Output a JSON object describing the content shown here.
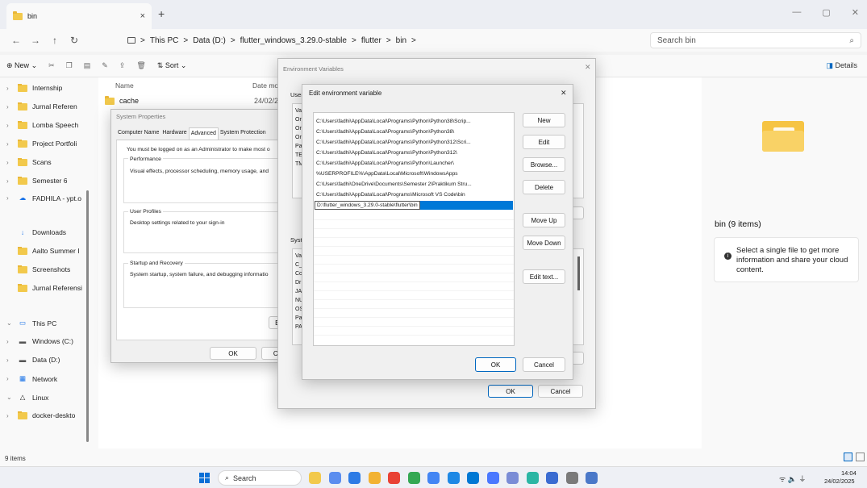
{
  "window": {
    "tab_title": "bin",
    "tab_close": "×",
    "tab_add": "+",
    "minimize": "—",
    "maximize": "▢",
    "close": "✕"
  },
  "nav": {
    "back": "←",
    "forward": "→",
    "up": "↑",
    "refresh": "↻"
  },
  "address": {
    "segments": [
      "This PC",
      "Data (D:)",
      "flutter_windows_3.29.0-stable",
      "flutter",
      "bin"
    ],
    "separator": ">"
  },
  "search": {
    "placeholder": "Search bin",
    "icon": "⌕"
  },
  "commandbar": {
    "new_label": "New",
    "sort_label": "Sort",
    "details_label": "Details"
  },
  "sidebar": {
    "items": [
      {
        "label": "Internship",
        "icon": "folder"
      },
      {
        "label": "Jurnal Referen",
        "icon": "folder"
      },
      {
        "label": "Lomba Speech",
        "icon": "folder"
      },
      {
        "label": "Project Portfoli",
        "icon": "folder"
      },
      {
        "label": "Scans",
        "icon": "folder"
      },
      {
        "label": "Semester 6",
        "icon": "folder"
      },
      {
        "label": "FADHILA - ypt.o",
        "icon": "cloud"
      },
      {
        "label": "Downloads",
        "icon": "download"
      },
      {
        "label": "Aalto Summer I",
        "icon": "folder"
      },
      {
        "label": "Screenshots",
        "icon": "folder"
      },
      {
        "label": "Jurnal Referensi",
        "icon": "folder"
      },
      {
        "label": "This PC",
        "icon": "monitor"
      },
      {
        "label": "Windows (C:)",
        "icon": "drive"
      },
      {
        "label": "Data (D:)",
        "icon": "drive"
      },
      {
        "label": "Network",
        "icon": "network"
      },
      {
        "label": "Linux",
        "icon": "linux"
      },
      {
        "label": "docker-deskto",
        "icon": "folder"
      }
    ]
  },
  "filelist": {
    "col_name": "Name",
    "col_date": "Date mo",
    "row_name": "cache",
    "row_date": "24/02/20"
  },
  "details_pane": {
    "title": "bin (9 items)",
    "message": "Select a single file to get more information and share your cloud content."
  },
  "status": {
    "items": "9 items"
  },
  "system_properties": {
    "title": "System Properties",
    "tabs": [
      "Computer Name",
      "Hardware",
      "Advanced",
      "System Protection"
    ],
    "admin_note": "You must be logged on as an Administrator to make most o",
    "perf_title": "Performance",
    "perf_desc": "Visual effects, processor scheduling, memory usage, and",
    "profiles_title": "User Profiles",
    "profiles_desc": "Desktop settings related to your sign-in",
    "startup_title": "Startup and Recovery",
    "startup_desc": "System startup, system failure, and debugging informatio",
    "env_btn": "Env",
    "ok": "OK",
    "cancel": "Ca"
  },
  "env_vars": {
    "title": "Environment Variables",
    "user_label": "User",
    "sys_label": "Syst",
    "user_col": [
      "Va",
      "On",
      "On",
      "On",
      "Pa",
      "TE",
      "TM"
    ],
    "sys_col": [
      "Va",
      "C_",
      "Co",
      "Dr",
      "JA",
      "NU",
      "OS",
      "Pa",
      "PA"
    ],
    "ok": "OK",
    "cancel": "Cancel"
  },
  "edit_env": {
    "title": "Edit environment variable",
    "close": "✕",
    "entries": [
      "C:\\Users\\fadhi\\AppData\\Local\\Programs\\Python\\Python38\\Scrip...",
      "C:\\Users\\fadhi\\AppData\\Local\\Programs\\Python\\Python38\\",
      "C:\\Users\\fadhi\\AppData\\Local\\Programs\\Python\\Python312\\Scri...",
      "C:\\Users\\fadhi\\AppData\\Local\\Programs\\Python\\Python312\\",
      "C:\\Users\\fadhi\\AppData\\Local\\Programs\\Python\\Launcher\\",
      "%USERPROFILE%\\AppData\\Local\\Microsoft\\WindowsApps",
      "C:\\Users\\fadhi\\OneDrive\\Documents\\Semester 2\\Praktikum Stru...",
      "C:\\Users\\fadhi\\AppData\\Local\\Programs\\Microsoft VS Code\\bin"
    ],
    "editing_value": "D:\\flutter_windows_3.29.0-stable\\flutter\\bin",
    "buttons": {
      "new": "New",
      "edit": "Edit",
      "browse": "Browse...",
      "delete": "Delete",
      "move_up": "Move Up",
      "move_down": "Move Down",
      "edit_text": "Edit text..."
    },
    "ok": "OK",
    "cancel": "Cancel"
  },
  "taskbar": {
    "search": "Search",
    "time": "14:04",
    "date": "24/02/2025",
    "tray": "ᯤ 🔈 ⏚",
    "apps": [
      {
        "name": "files-app",
        "color": "#f2c94c"
      },
      {
        "name": "copilot-app",
        "color": "#5b8def"
      },
      {
        "name": "store-app",
        "color": "#2d7be5"
      },
      {
        "name": "explorer-app",
        "color": "#f2b233"
      },
      {
        "name": "chrome-app",
        "color": "#e94235"
      },
      {
        "name": "chrome-alt-app",
        "color": "#34a853"
      },
      {
        "name": "chrome-dev-app",
        "color": "#4285f4"
      },
      {
        "name": "edge-app",
        "color": "#1e88e5"
      },
      {
        "name": "vscode-app",
        "color": "#0078d4"
      },
      {
        "name": "photos-app",
        "color": "#4a78ff"
      },
      {
        "name": "r-app",
        "color": "#7a8cd6"
      },
      {
        "name": "kite-app",
        "color": "#2bb6a4"
      },
      {
        "name": "arrow-app",
        "color": "#3a6bd1"
      },
      {
        "name": "settings-app",
        "color": "#7a7a7a"
      },
      {
        "name": "sysprop-app",
        "color": "#4a78c8"
      }
    ]
  }
}
